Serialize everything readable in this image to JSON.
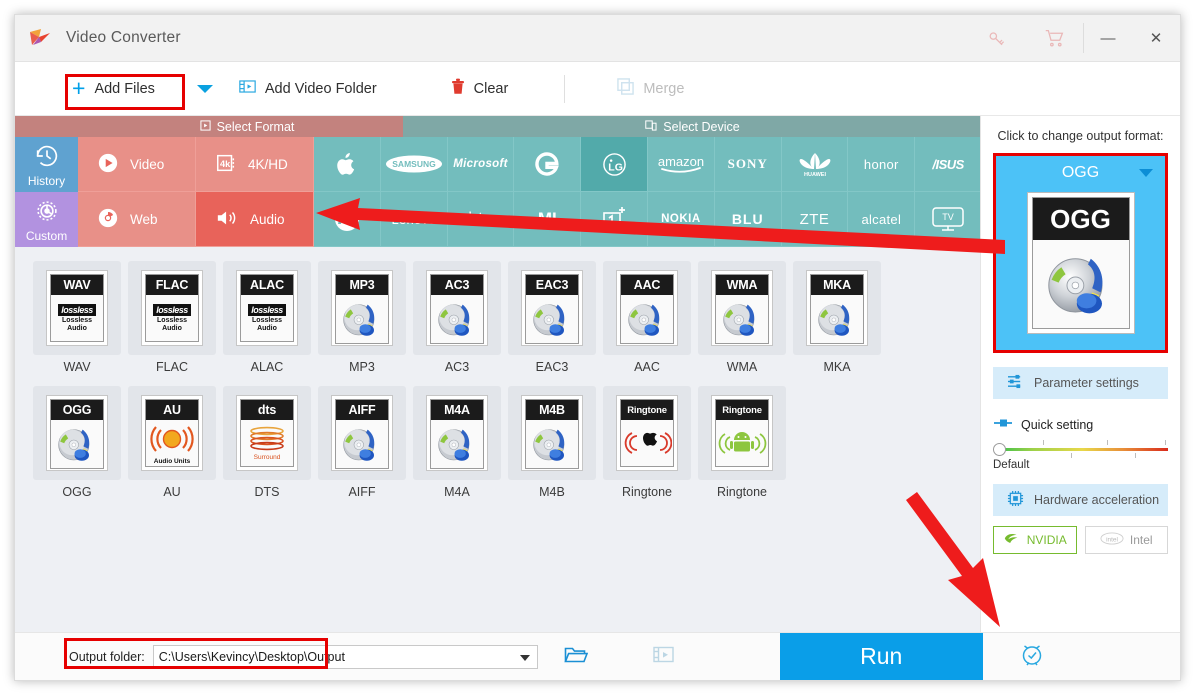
{
  "window": {
    "title": "Video Converter",
    "logo_icon": "play-logo-icon",
    "key_icon": "key-icon",
    "cart_icon": "cart-icon",
    "minimize_label": "—",
    "close_label": "✕"
  },
  "toolbar": {
    "add_files_label": "Add Files",
    "add_files_icon": "plus-icon",
    "dropdown_icon": "caret-down-icon",
    "add_video_folder_label": "Add Video Folder",
    "add_video_folder_icon": "video-folder-icon",
    "clear_label": "Clear",
    "clear_icon": "trash-icon",
    "merge_label": "Merge",
    "merge_icon": "merge-icon"
  },
  "categories": {
    "select_format_label": "Select Format",
    "select_format_icon": "film-icon",
    "select_device_label": "Select Device",
    "select_device_icon": "devices-icon",
    "side": [
      {
        "label": "History",
        "icon": "history-clock-icon"
      },
      {
        "label": "Custom",
        "icon": "gear-icon"
      }
    ],
    "formats": [
      {
        "label": "Video",
        "icon": "play-circle-icon",
        "selected": false
      },
      {
        "label": "4K/HD",
        "icon": "4k-icon",
        "selected": false
      },
      {
        "label": "Web",
        "icon": "chrome-icon",
        "selected": false
      },
      {
        "label": "Audio",
        "icon": "speaker-icon",
        "selected": true
      }
    ],
    "devices_row1": [
      {
        "name": "Apple",
        "mark": "",
        "icon": "apple-logo-icon",
        "selected": false
      },
      {
        "name": "SAMSUNG",
        "mark": "SAMSUNG",
        "icon": "samsung-logo-icon",
        "selected": false
      },
      {
        "name": "Microsoft",
        "mark": "Microsoft",
        "icon": "microsoft-logo-icon",
        "selected": false
      },
      {
        "name": "Google",
        "mark": "G",
        "icon": "google-logo-icon",
        "selected": false
      },
      {
        "name": "LG",
        "mark": "LG",
        "icon": "lg-logo-icon",
        "selected": true
      },
      {
        "name": "amazon",
        "mark": "amazon",
        "icon": "amazon-logo-icon",
        "selected": false
      },
      {
        "name": "SONY",
        "mark": "SONY",
        "icon": "sony-logo-icon",
        "selected": false
      },
      {
        "name": "HUAWEI",
        "mark": "HUAWEI",
        "icon": "huawei-logo-icon",
        "selected": false
      },
      {
        "name": "honor",
        "mark": "honor",
        "icon": "honor-logo-icon",
        "selected": false
      },
      {
        "name": "ASUS",
        "mark": "/ISUS",
        "icon": "asus-logo-icon",
        "selected": false
      }
    ],
    "devices_row2": [
      {
        "name": "Motorola",
        "mark": "M",
        "icon": "motorola-logo-icon",
        "selected": false
      },
      {
        "name": "Lenovo",
        "mark": "Lenovo",
        "icon": "lenovo-logo-icon",
        "selected": false
      },
      {
        "name": "HTC",
        "mark": "htc",
        "icon": "htc-logo-icon",
        "selected": false
      },
      {
        "name": "MI",
        "mark": "MI",
        "icon": "xiaomi-logo-icon",
        "selected": false
      },
      {
        "name": "OnePlus",
        "mark": "1+",
        "icon": "oneplus-logo-icon",
        "selected": false
      },
      {
        "name": "NOKIA",
        "mark": "NOKIA",
        "icon": "nokia-logo-icon",
        "selected": false
      },
      {
        "name": "BLU",
        "mark": "BLU",
        "icon": "blu-logo-icon",
        "selected": false
      },
      {
        "name": "ZTE",
        "mark": "ZTE",
        "icon": "zte-logo-icon",
        "selected": false
      },
      {
        "name": "alcatel",
        "mark": "alcatel",
        "icon": "alcatel-logo-icon",
        "selected": false
      },
      {
        "name": "TV",
        "mark": "TV",
        "icon": "tv-icon",
        "selected": false
      }
    ]
  },
  "format_grid": [
    {
      "label": "WAV",
      "badge": "WAV",
      "art": "lossless"
    },
    {
      "label": "FLAC",
      "badge": "FLAC",
      "art": "lossless"
    },
    {
      "label": "ALAC",
      "badge": "ALAC",
      "art": "lossless"
    },
    {
      "label": "MP3",
      "badge": "MP3",
      "art": "cd-note"
    },
    {
      "label": "AC3",
      "badge": "AC3",
      "art": "cd-note"
    },
    {
      "label": "EAC3",
      "badge": "EAC3",
      "art": "cd-note"
    },
    {
      "label": "AAC",
      "badge": "AAC",
      "art": "cd-note"
    },
    {
      "label": "WMA",
      "badge": "WMA",
      "art": "cd-note"
    },
    {
      "label": "MKA",
      "badge": "MKA",
      "art": "cd-note"
    },
    {
      "label": "OGG",
      "badge": "OGG",
      "art": "cd-note"
    },
    {
      "label": "AU",
      "badge": "AU",
      "art": "audio-units"
    },
    {
      "label": "DTS",
      "badge": "dts",
      "art": "dts-surround"
    },
    {
      "label": "AIFF",
      "badge": "AIFF",
      "art": "cd-note"
    },
    {
      "label": "M4A",
      "badge": "M4A",
      "art": "cd-note"
    },
    {
      "label": "M4B",
      "badge": "M4B",
      "art": "cd-note"
    },
    {
      "label": "Ringtone",
      "badge": "Ringtone",
      "art": "apple-ring"
    },
    {
      "label": "Ringtone",
      "badge": "Ringtone",
      "art": "android-ring"
    }
  ],
  "lossless": {
    "badge": "lossless",
    "line1": "Lossless",
    "line2": "Audio"
  },
  "dts": {
    "sub": "Surround"
  },
  "au": {
    "sub": "Audio Units"
  },
  "right_panel": {
    "hint": "Click to change output format:",
    "output_format": "OGG",
    "output_caret_icon": "caret-down-icon",
    "parameter_settings_label": "Parameter settings",
    "parameter_settings_icon": "sliders-icon",
    "quick_setting_label": "Quick setting",
    "quick_setting_icon": "quick-slider-icon",
    "slider_label": "Default",
    "hardware_acceleration_label": "Hardware acceleration",
    "hardware_acceleration_icon": "cpu-icon",
    "nvidia_label": "NVIDIA",
    "nvidia_icon": "nvidia-logo-icon",
    "intel_label": "Intel",
    "intel_icon": "intel-logo-icon"
  },
  "bottom": {
    "output_folder_label": "Output folder:",
    "output_folder_path": "C:\\Users\\Kevincy\\Desktop\\Output",
    "open_folder_icon": "open-folder-icon",
    "media_folder_icon": "media-folder-icon",
    "run_label": "Run",
    "alarm_icon": "alarm-clock-icon"
  },
  "colors": {
    "accent_blue": "#0a9ee8",
    "format_red": "#e89088",
    "format_red_selected": "#e8635a",
    "device_teal": "#73bdbd",
    "device_teal_selected": "#52aaaa",
    "history_blue": "#5fa2d0",
    "custom_purple": "#b292e0",
    "highlight_red": "#e60000",
    "output_panel_blue": "#4cc2f7"
  }
}
